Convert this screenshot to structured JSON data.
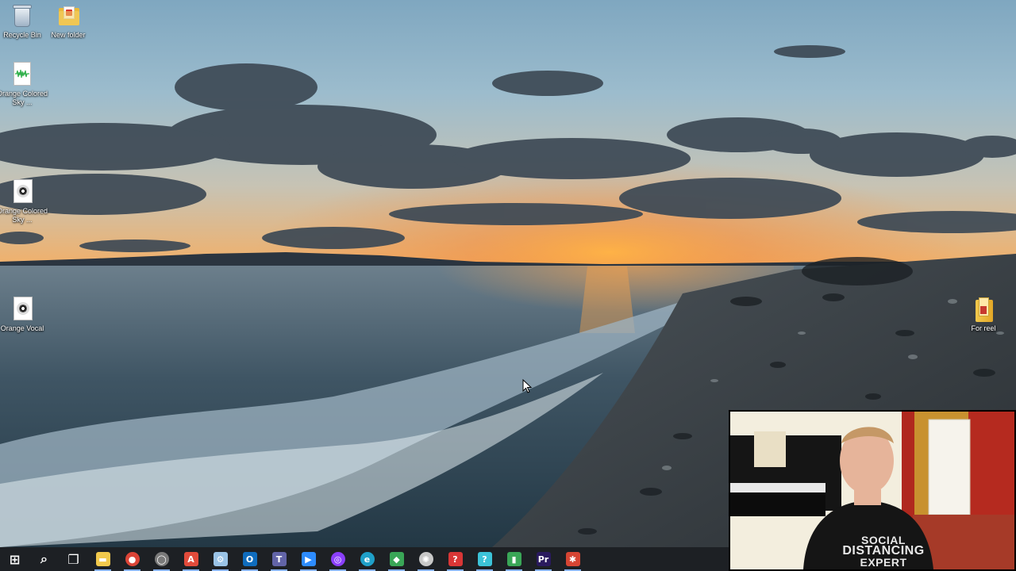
{
  "desktop": {
    "icons": [
      {
        "label": "Recycle Bin",
        "icon": "recycle-bin-icon"
      },
      {
        "label": "New folder",
        "icon": "folder-icon"
      },
      {
        "label": "Orange Colored Sky ...",
        "icon": "audio-waveform-file-icon"
      },
      {
        "label": "Orange Colored Sky ...",
        "icon": "audio-file-icon"
      },
      {
        "label": "Orange Vocal",
        "icon": "audio-file-icon"
      },
      {
        "label": "For reel",
        "icon": "folder-icon"
      }
    ]
  },
  "webcam": {
    "shirt_line1": "SOCIAL",
    "shirt_line2": "DISTANCING",
    "shirt_line3": "EXPERT"
  },
  "taskbar": {
    "apps": [
      {
        "name": "start-button",
        "icon": "windows-logo-icon",
        "glyph": "⊞",
        "color": "#ffffff"
      },
      {
        "name": "search-button",
        "icon": "search-icon",
        "glyph": "⌕",
        "color": "#ffffff"
      },
      {
        "name": "task-view-button",
        "icon": "task-view-icon",
        "glyph": "❐",
        "color": "#ffffff"
      },
      {
        "name": "file-explorer",
        "icon": "file-explorer-icon",
        "glyph": "▬",
        "color": "#f2c94c"
      },
      {
        "name": "chrome",
        "icon": "chrome-icon",
        "glyph": "●",
        "color": "#db4437"
      },
      {
        "name": "app-circle",
        "icon": "ring-app-icon",
        "glyph": "◯",
        "color": "#7a7a7a"
      },
      {
        "name": "app-a",
        "icon": "letter-a-app-icon",
        "glyph": "A",
        "color": "#e24b3b"
      },
      {
        "name": "steam",
        "icon": "steam-icon",
        "glyph": "⚙",
        "color": "#9ac3e6"
      },
      {
        "name": "outlook",
        "icon": "outlook-icon",
        "glyph": "O",
        "color": "#0f6cbd"
      },
      {
        "name": "teams",
        "icon": "teams-icon",
        "glyph": "T",
        "color": "#6264a7"
      },
      {
        "name": "zoom",
        "icon": "zoom-icon",
        "glyph": "▶",
        "color": "#2d8cff"
      },
      {
        "name": "app-purple-ring",
        "icon": "purple-ring-app-icon",
        "glyph": "◎",
        "color": "#8a3ffc"
      },
      {
        "name": "edge",
        "icon": "edge-icon",
        "glyph": "e",
        "color": "#1fa0c9"
      },
      {
        "name": "app-green-leaf",
        "icon": "green-leaf-app-icon",
        "glyph": "◆",
        "color": "#3aa657"
      },
      {
        "name": "app-aperture",
        "icon": "aperture-app-icon",
        "glyph": "✺",
        "color": "#c8c8c8"
      },
      {
        "name": "app-red-chat",
        "icon": "red-chat-app-icon",
        "glyph": "?",
        "color": "#d93636"
      },
      {
        "name": "app-cyan-chat",
        "icon": "cyan-chat-app-icon",
        "glyph": "?",
        "color": "#3cc3d8"
      },
      {
        "name": "app-meter",
        "icon": "level-meter-app-icon",
        "glyph": "▮",
        "color": "#3aa657"
      },
      {
        "name": "premiere-pro",
        "icon": "premiere-pro-icon",
        "glyph": "Pr",
        "color": "#2a1a5e"
      },
      {
        "name": "app-red-figure",
        "icon": "red-figure-app-icon",
        "glyph": "✱",
        "color": "#d64533"
      }
    ]
  }
}
